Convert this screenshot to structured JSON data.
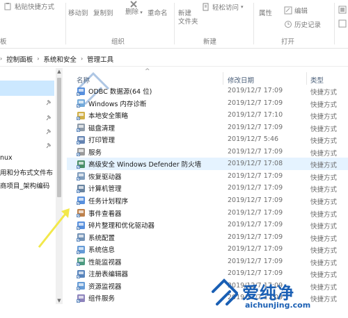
{
  "ribbon": {
    "paste_shortcut": "粘贴快捷方式",
    "move_to": "移动到",
    "copy_to": "复制到",
    "delete": "删除",
    "rename": "重命名",
    "new_folder": "新建\n文件夹",
    "easy_access": "轻松访问",
    "properties": "属性",
    "edit": "编辑",
    "history": "历史记录",
    "group_organize": "组织",
    "group_new": "新建",
    "group_open": "打开"
  },
  "address": {
    "crumbs": [
      "控制面板",
      "系统和安全",
      "管理工具"
    ]
  },
  "nav": {
    "items": [
      "nux",
      "用和分布式文件布",
      "商项目_架构编码"
    ]
  },
  "columns": {
    "name": "名称",
    "date": "修改日期",
    "type": "类型"
  },
  "files": [
    {
      "name": "ODBC 数据源(64 位)",
      "date": "2019/12/7 17:09",
      "type": "快捷方式",
      "icon": "odbc-icon"
    },
    {
      "name": "Windows 内存诊断",
      "date": "2019/12/7 17:09",
      "type": "快捷方式",
      "icon": "memory-diagnostic-icon"
    },
    {
      "name": "本地安全策略",
      "date": "2019/12/7 17:10",
      "type": "快捷方式",
      "icon": "security-policy-icon"
    },
    {
      "name": "磁盘清理",
      "date": "2019/12/7 17:09",
      "type": "快捷方式",
      "icon": "disk-cleanup-icon"
    },
    {
      "name": "打印管理",
      "date": "2019/12/7 5:46",
      "type": "快捷方式",
      "icon": "print-management-icon"
    },
    {
      "name": "服务",
      "date": "2019/12/7 17:09",
      "type": "快捷方式",
      "icon": "services-icon"
    },
    {
      "name": "高级安全 Windows Defender 防火墙",
      "date": "2019/12/7 17:08",
      "type": "快捷方式",
      "icon": "firewall-icon"
    },
    {
      "name": "恢复驱动器",
      "date": "2019/12/7 17:09",
      "type": "快捷方式",
      "icon": "recovery-drive-icon"
    },
    {
      "name": "计算机管理",
      "date": "2019/12/7 17:09",
      "type": "快捷方式",
      "icon": "computer-management-icon"
    },
    {
      "name": "任务计划程序",
      "date": "2019/12/7 17:09",
      "type": "快捷方式",
      "icon": "task-scheduler-icon"
    },
    {
      "name": "事件查看器",
      "date": "2019/12/7 17:09",
      "type": "快捷方式",
      "icon": "event-viewer-icon"
    },
    {
      "name": "碎片整理和优化驱动器",
      "date": "2019/12/7 17:09",
      "type": "快捷方式",
      "icon": "defrag-icon"
    },
    {
      "name": "系统配置",
      "date": "2019/12/7 17:09",
      "type": "快捷方式",
      "icon": "system-config-icon"
    },
    {
      "name": "系统信息",
      "date": "2019/12/7 17:09",
      "type": "快捷方式",
      "icon": "system-info-icon"
    },
    {
      "name": "性能监视器",
      "date": "2019/12/7 17:09",
      "type": "快捷方式",
      "icon": "performance-monitor-icon"
    },
    {
      "name": "注册表编辑器",
      "date": "2019/12/7 17:09",
      "type": "快捷方式",
      "icon": "registry-editor-icon"
    },
    {
      "name": "资源监视器",
      "date": "2019/12/7 17:09",
      "type": "快捷方式",
      "icon": "resource-monitor-icon"
    },
    {
      "name": "组件服务",
      "date": "2019/12/7 17:09",
      "type": "快捷方式",
      "icon": "component-services-icon"
    }
  ],
  "watermark": {
    "title": "爱纯净",
    "url": "aichunjing.com"
  },
  "colors": {
    "selection": "#cce8ff",
    "row_hover": "#e5f3ff",
    "header_text": "#4c607a",
    "accent": "#1a5fb4",
    "arrow": "#f2e84a"
  }
}
